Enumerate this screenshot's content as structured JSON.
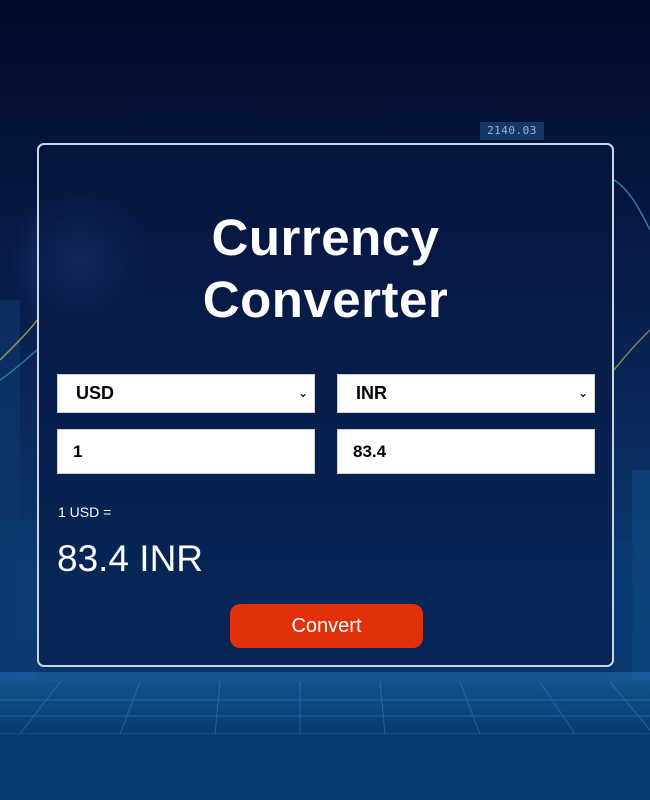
{
  "background": {
    "ticker_text": "2140.03"
  },
  "converter": {
    "title_line1": "Currency",
    "title_line2": "Converter",
    "from_currency": "USD",
    "to_currency": "INR",
    "amount_value": "1",
    "result_value": "83.4",
    "rate_label": "1 USD =",
    "rate_value": "83.4 INR",
    "convert_label": "Convert",
    "dropdown_icon": "chevron-down-icon"
  },
  "colors": {
    "accent_button": "#e2300b",
    "card_border": "#c9d6e6",
    "background_dark": "#040b2a"
  }
}
